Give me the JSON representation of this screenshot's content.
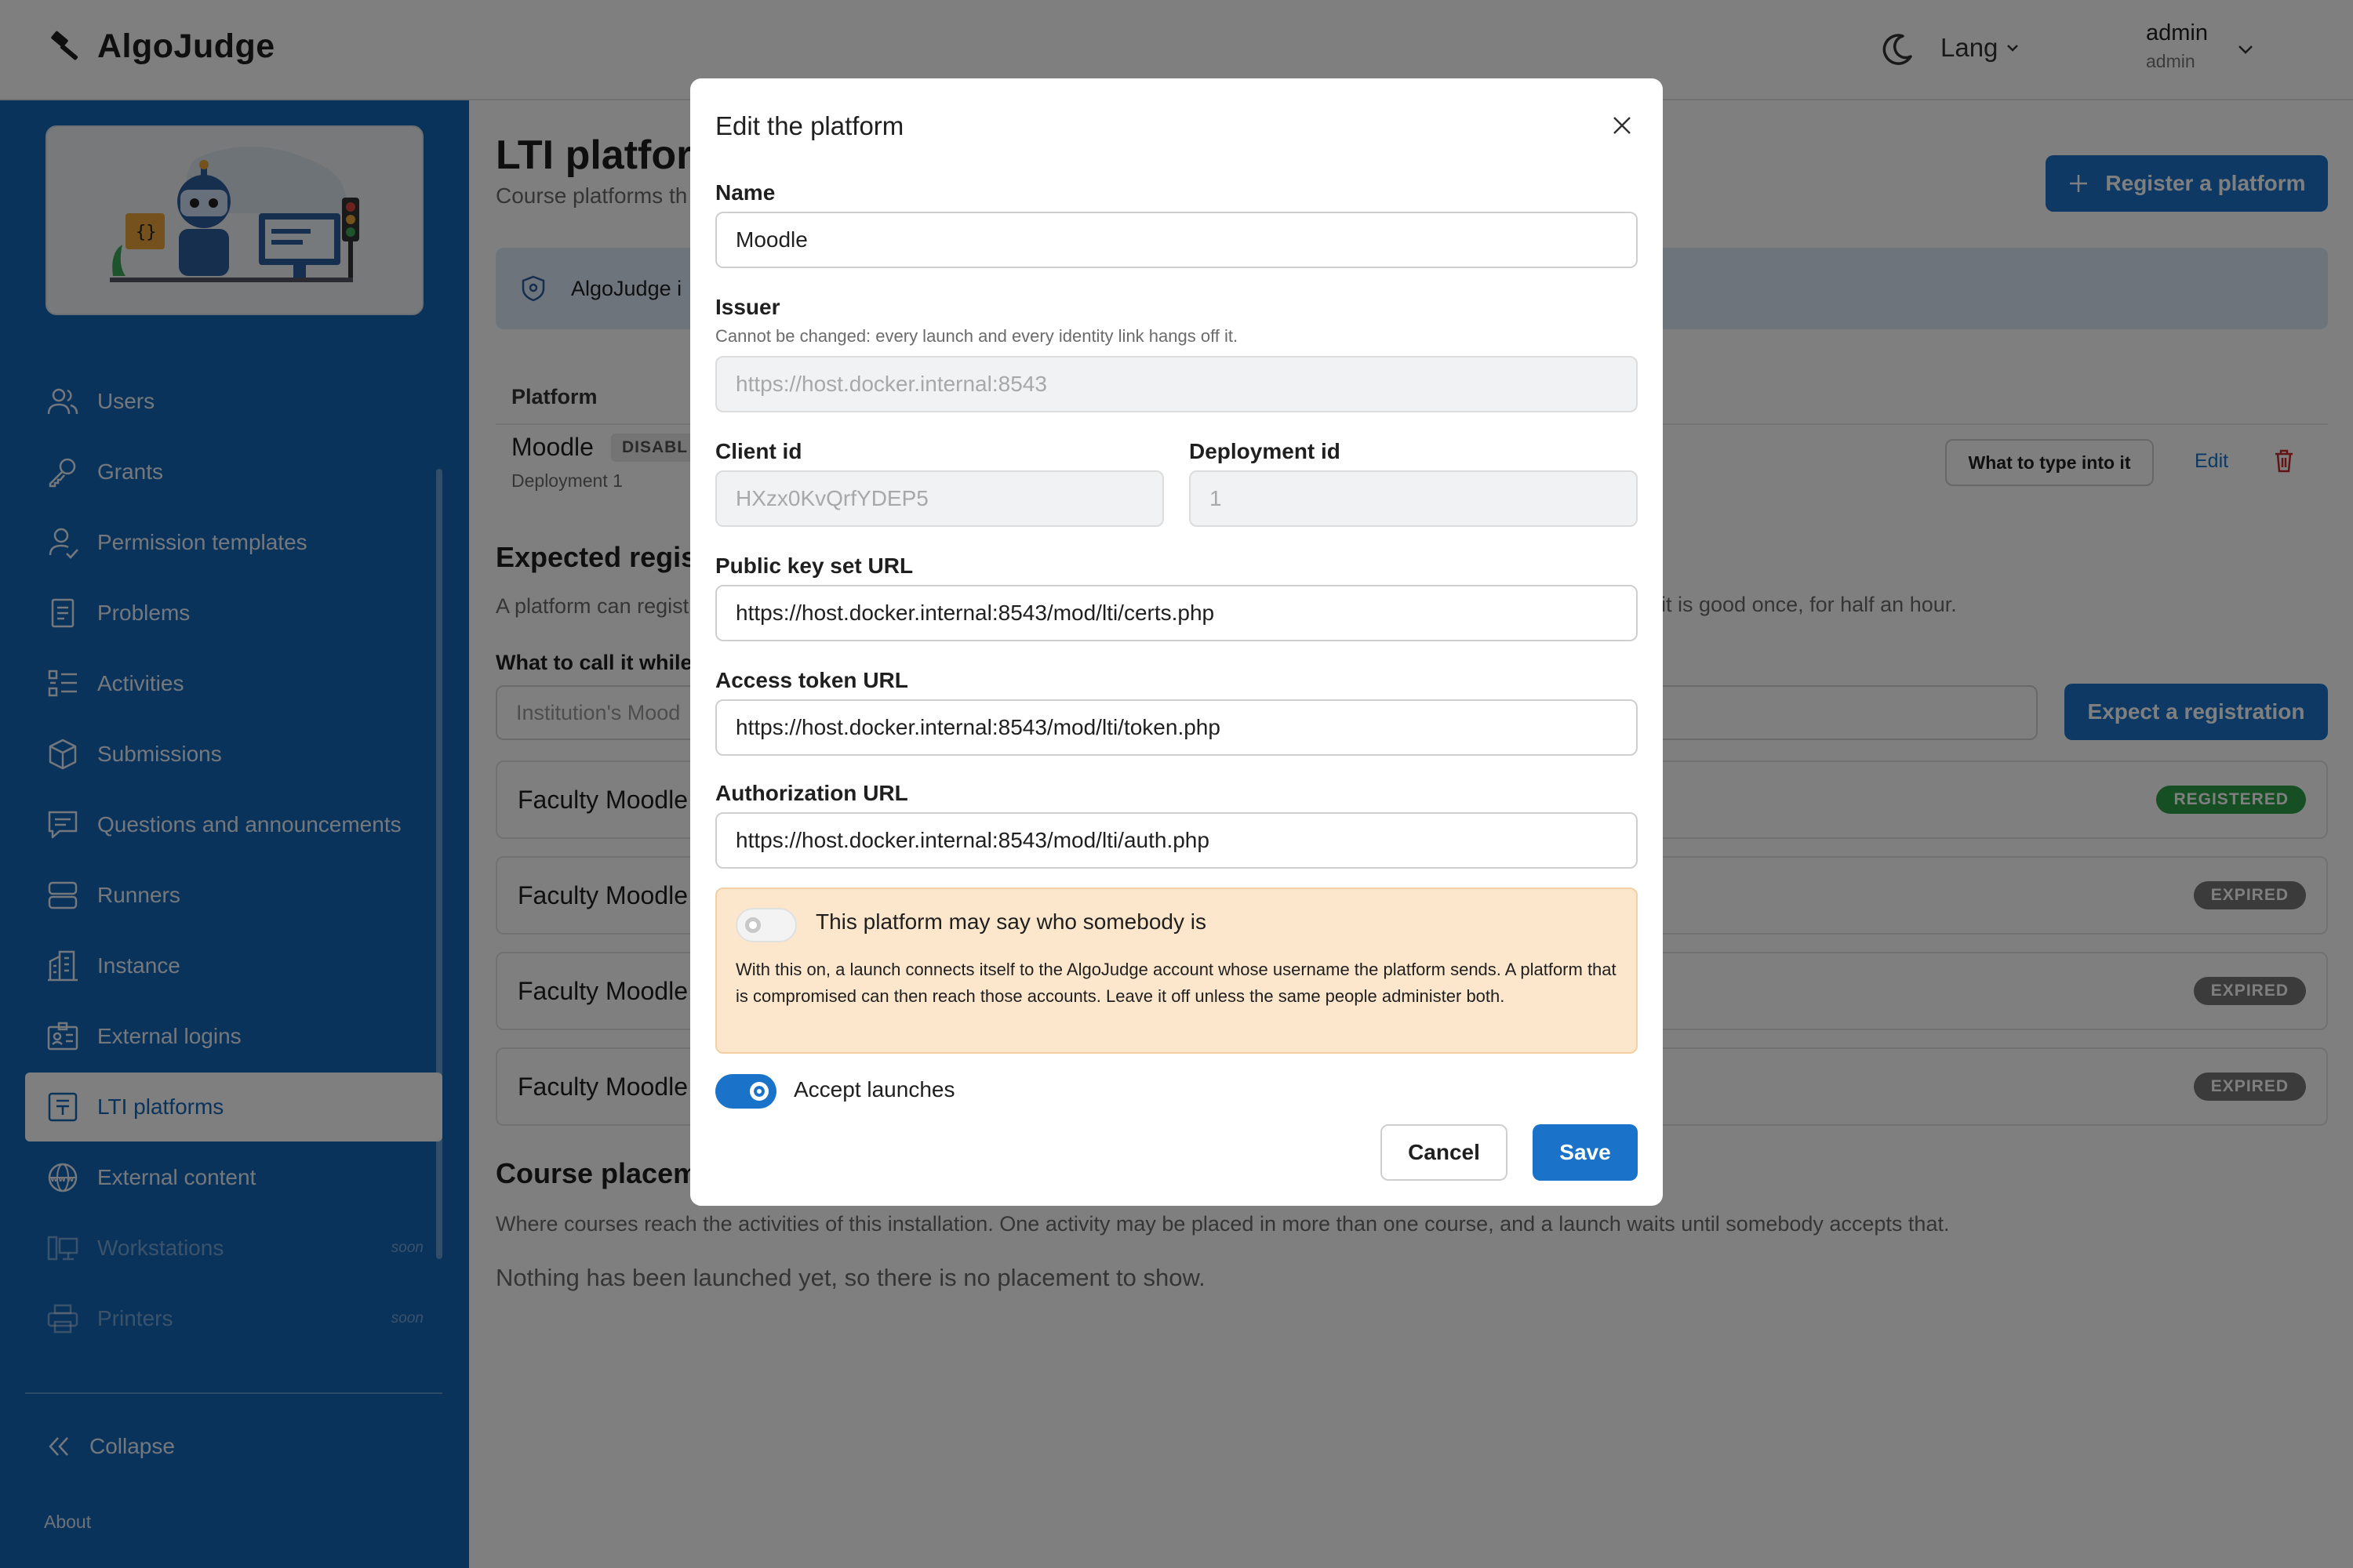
{
  "header": {
    "app_name": "AlgoJudge",
    "lang_label": "Lang",
    "user_name": "admin",
    "user_role": "admin"
  },
  "sidebar": {
    "items": [
      {
        "label": "Users",
        "icon": "users-icon"
      },
      {
        "label": "Grants",
        "icon": "key-icon"
      },
      {
        "label": "Permission templates",
        "icon": "user-check-icon"
      },
      {
        "label": "Problems",
        "icon": "document-icon"
      },
      {
        "label": "Activities",
        "icon": "list-icon"
      },
      {
        "label": "Submissions",
        "icon": "cube-icon"
      },
      {
        "label": "Questions and announcements",
        "icon": "chat-icon"
      },
      {
        "label": "Runners",
        "icon": "server-icon"
      },
      {
        "label": "Instance",
        "icon": "building-icon"
      },
      {
        "label": "External logins",
        "icon": "id-card-icon"
      },
      {
        "label": "LTI platforms",
        "icon": "lti-icon"
      },
      {
        "label": "External content",
        "icon": "globe-icon"
      },
      {
        "label": "Workstations",
        "icon": "workstation-icon",
        "soon": "soon"
      },
      {
        "label": "Printers",
        "icon": "printer-icon",
        "soon": "soon"
      }
    ],
    "collapse_label": "Collapse",
    "about_label": "About"
  },
  "main": {
    "title": "LTI platfor",
    "subtitle": "Course platforms th",
    "register_button": "Register a platform",
    "info_text": "AlgoJudge i",
    "table_header_platform": "Platform",
    "platform_row": {
      "name": "Moodle",
      "badge": "DISABL",
      "sub": "Deployment 1",
      "type_button": "What to type into it",
      "edit_link": "Edit"
    },
    "expected": {
      "title": "Expected regist",
      "text": "A platform can regist",
      "text_right": "it is good once, for half an hour.",
      "field_label": "What to call it while",
      "input_placeholder": "Institution's Mood",
      "button": "Expect a registration",
      "cards": [
        {
          "name": "Faculty Moodle",
          "status": "REGISTERED"
        },
        {
          "name": "Faculty Moodle",
          "status": "EXPIRED"
        },
        {
          "name": "Faculty Moodle",
          "status": "EXPIRED"
        },
        {
          "name": "Faculty Moodle",
          "status": "EXPIRED"
        }
      ]
    },
    "placements": {
      "title": "Course placeme",
      "text": "Where courses reach the activities of this installation. One activity may be placed in more than one course, and a launch waits until somebody accepts that.",
      "empty": "Nothing has been launched yet, so there is no placement to show."
    }
  },
  "modal": {
    "title": "Edit the platform",
    "name_label": "Name",
    "name_value": "Moodle",
    "issuer_label": "Issuer",
    "issuer_help": "Cannot be changed: every launch and every identity link hangs off it.",
    "issuer_value": "https://host.docker.internal:8543",
    "client_id_label": "Client id",
    "client_id_value": "HXzx0KvQrfYDEP5",
    "deployment_id_label": "Deployment id",
    "deployment_id_value": "1",
    "jwks_label": "Public key set URL",
    "jwks_value": "https://host.docker.internal:8543/mod/lti/certs.php",
    "token_label": "Access token URL",
    "token_value": "https://host.docker.internal:8543/mod/lti/token.php",
    "auth_label": "Authorization URL",
    "auth_value": "https://host.docker.internal:8543/mod/lti/auth.php",
    "identity_toggle_label": "This platform may say who somebody is",
    "identity_toggle_on": false,
    "identity_warning": "With this on, a launch connects itself to the AlgoJudge account whose username the platform sends. A platform that is compromised can then reach those accounts. Leave it off unless the same people administer both.",
    "accept_launches_label": "Accept launches",
    "accept_launches_on": true,
    "cancel_label": "Cancel",
    "save_label": "Save"
  },
  "colors": {
    "sidebar_bg": "#1467b8",
    "primary": "#1a73c8",
    "registered": "#2e9e4a",
    "expired": "#777777",
    "warning_bg": "#fde7cc"
  }
}
